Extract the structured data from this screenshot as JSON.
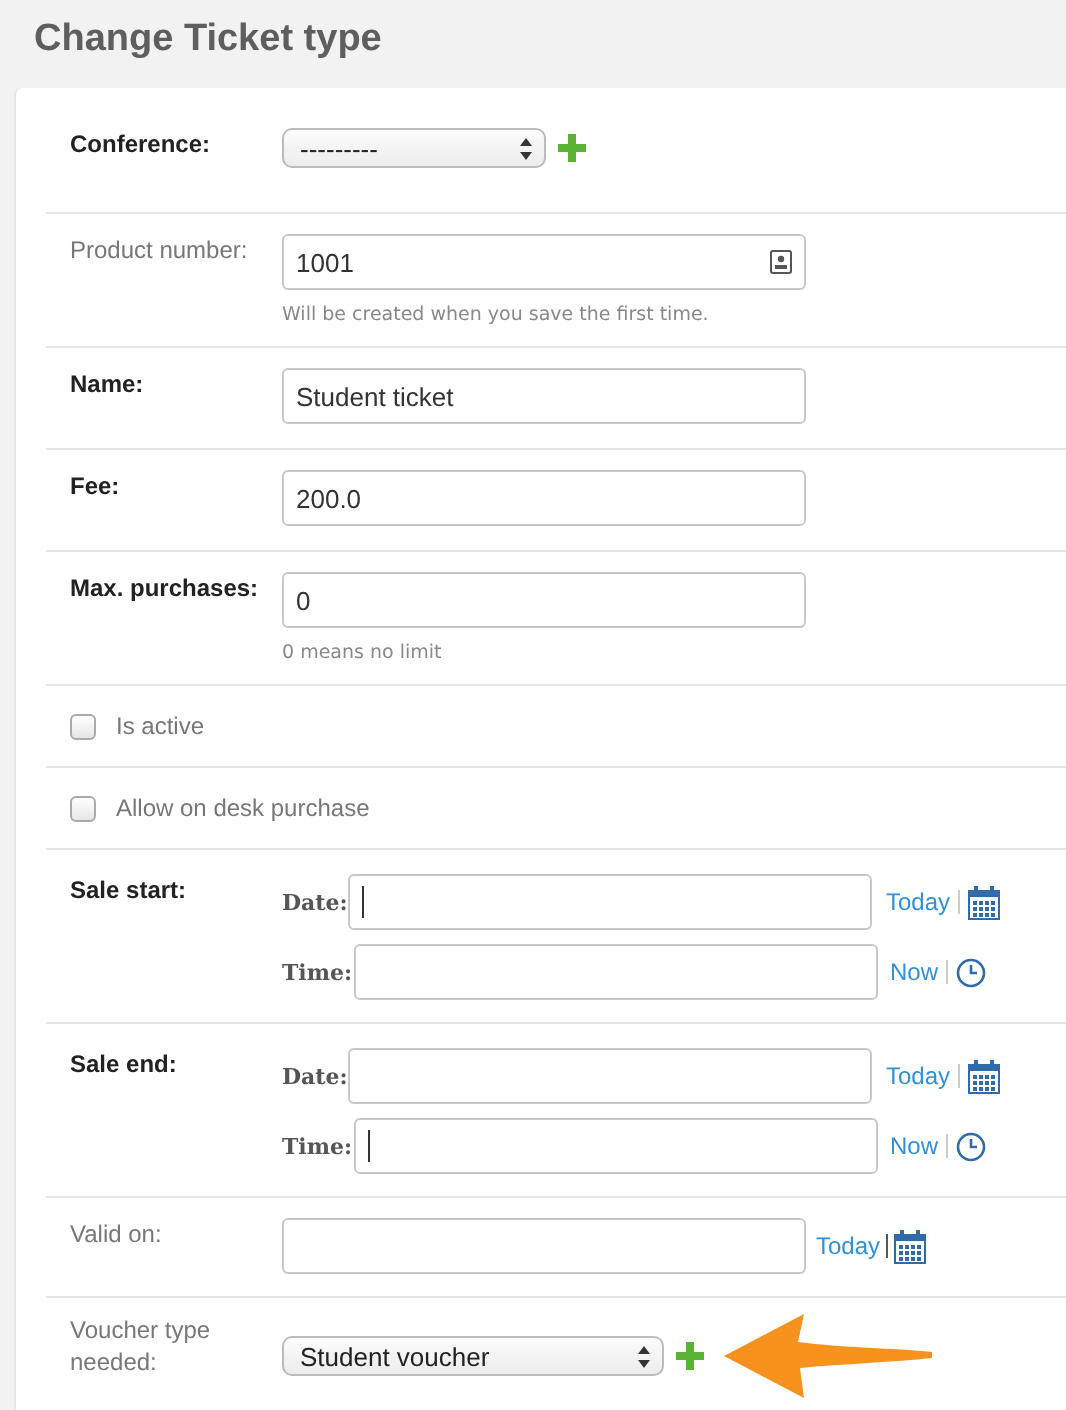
{
  "title": "Change Ticket type",
  "rows": [
    {
      "kind": "select",
      "label": "Conference:",
      "required": true,
      "value": "---------",
      "add": true
    },
    {
      "kind": "text",
      "label": "Product number:",
      "required": false,
      "value": "1001",
      "readonly_icon": true,
      "help": "Will be created when you save the first time."
    },
    {
      "kind": "text",
      "label": "Name:",
      "required": true,
      "value": "Student ticket"
    },
    {
      "kind": "text",
      "label": "Fee:",
      "required": true,
      "value": "200.0"
    },
    {
      "kind": "text",
      "label": "Max. purchases:",
      "required": true,
      "value": "0",
      "help": "0 means no limit"
    },
    {
      "kind": "checkbox",
      "label": "Is active",
      "checked": false
    },
    {
      "kind": "checkbox",
      "label": "Allow on desk purchase",
      "checked": false
    },
    {
      "kind": "datetime",
      "label": "Sale start:",
      "required": true,
      "date_label": "Date:",
      "date_link": "Today",
      "date_cursor": true,
      "time_label": "Time:",
      "time_link": "Now",
      "time_cursor": false
    },
    {
      "kind": "datetime",
      "label": "Sale end:",
      "required": true,
      "date_label": "Date:",
      "date_link": "Today",
      "date_cursor": false,
      "time_label": "Time:",
      "time_link": "Now",
      "time_cursor": true
    },
    {
      "kind": "date",
      "label": "Valid on:",
      "required": false,
      "link": "Today"
    },
    {
      "kind": "select",
      "label": "Voucher type needed:",
      "required": false,
      "value": "Student voucher",
      "add": true,
      "highlighted": true
    }
  ]
}
